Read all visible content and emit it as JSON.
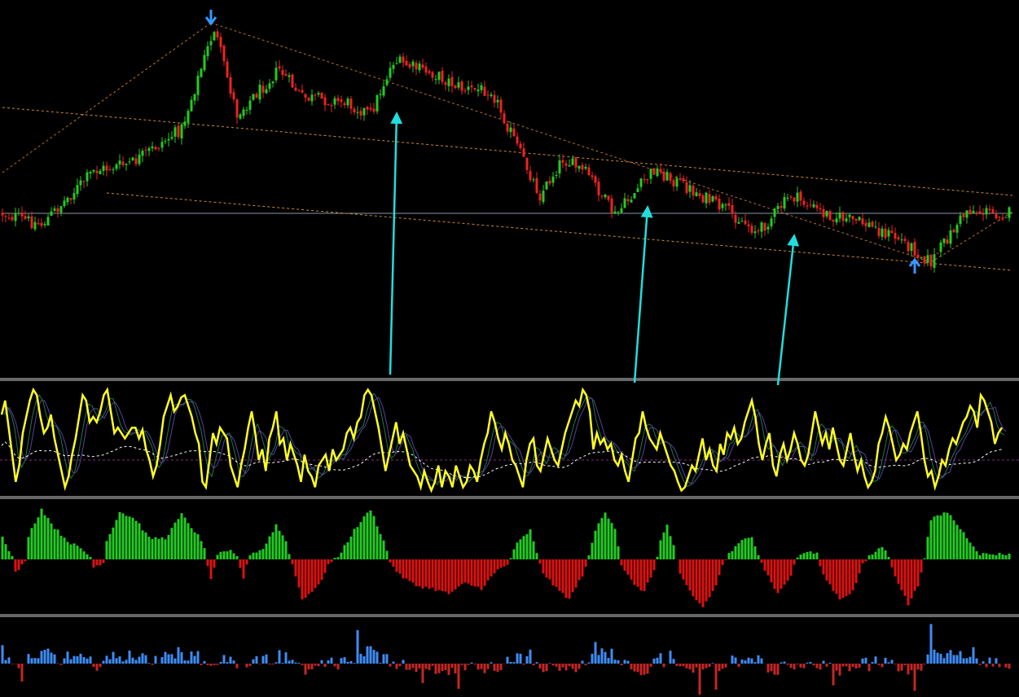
{
  "chart_data": [
    {
      "type": "candlestick",
      "panel": "price",
      "colors": {
        "up": "#22cc22",
        "down": "#ee2222",
        "wick_up": "#22cc22",
        "wick_down": "#ee2222"
      },
      "key_points": [
        {
          "bar": 0,
          "price": 262
        },
        {
          "bar": 12,
          "price": 276
        },
        {
          "bar": 28,
          "price": 210
        },
        {
          "bar": 40,
          "price": 200
        },
        {
          "bar": 55,
          "price": 158
        },
        {
          "bar": 65,
          "price": 35
        },
        {
          "bar": 72,
          "price": 140
        },
        {
          "bar": 85,
          "price": 85
        },
        {
          "bar": 92,
          "price": 120
        },
        {
          "bar": 105,
          "price": 125
        },
        {
          "bar": 113,
          "price": 140
        },
        {
          "bar": 120,
          "price": 75
        },
        {
          "bar": 132,
          "price": 90
        },
        {
          "bar": 142,
          "price": 110
        },
        {
          "bar": 150,
          "price": 110
        },
        {
          "bar": 158,
          "price": 180
        },
        {
          "bar": 165,
          "price": 240
        },
        {
          "bar": 172,
          "price": 195
        },
        {
          "bar": 180,
          "price": 215
        },
        {
          "bar": 188,
          "price": 265
        },
        {
          "bar": 200,
          "price": 208
        },
        {
          "bar": 210,
          "price": 230
        },
        {
          "bar": 222,
          "price": 258
        },
        {
          "bar": 232,
          "price": 285
        },
        {
          "bar": 242,
          "price": 240
        },
        {
          "bar": 252,
          "price": 262
        },
        {
          "bar": 265,
          "price": 275
        },
        {
          "bar": 276,
          "price": 295
        },
        {
          "bar": 285,
          "price": 322
        },
        {
          "bar": 296,
          "price": 258
        },
        {
          "bar": 305,
          "price": 262
        }
      ],
      "signals": [
        {
          "kind": "sell-arrow",
          "bar": 64,
          "color": "#3399ff"
        },
        {
          "kind": "buy-arrow",
          "bar": 280,
          "color": "#3399ff"
        }
      ],
      "lines": [
        {
          "name": "horizontal",
          "from": [
            0,
            262
          ],
          "to": [
            310,
            262
          ],
          "color": "#8899aa",
          "style": "solid"
        },
        {
          "name": "channel-upper",
          "from": [
            0,
            132
          ],
          "to": [
            310,
            240
          ],
          "color": "#d08a30",
          "style": "dashed"
        },
        {
          "name": "channel-lower",
          "from": [
            32,
            237
          ],
          "to": [
            310,
            332
          ],
          "color": "#d08a30",
          "style": "dashed"
        },
        {
          "name": "trend-rise",
          "from": [
            0,
            212
          ],
          "to": [
            64,
            28
          ],
          "color": "#b86e25",
          "style": "dashed"
        },
        {
          "name": "trend-fall",
          "from": [
            64,
            28
          ],
          "to": [
            285,
            322
          ],
          "color": "#b86e25",
          "style": "dashed"
        },
        {
          "name": "trend-end",
          "from": [
            285,
            322
          ],
          "to": [
            310,
            260
          ],
          "color": "#b86e25",
          "style": "dashed"
        }
      ],
      "annotation_arrows": [
        {
          "from_bar": 119,
          "from_y": 460,
          "to_bar": 121,
          "to_y": 140,
          "color": "#22dddd"
        },
        {
          "from_bar": 194,
          "from_y": 470,
          "to_bar": 198,
          "to_y": 255,
          "color": "#22dddd"
        },
        {
          "from_bar": 238,
          "from_y": 473,
          "to_bar": 243,
          "to_y": 290,
          "color": "#22dddd"
        }
      ]
    },
    {
      "type": "line",
      "panel": "oscillator",
      "series": [
        {
          "role": "main",
          "color": "#ffff22",
          "width": 2.5
        },
        {
          "role": "shadow-1",
          "color": "#1c7a4a",
          "width": 1
        },
        {
          "role": "shadow-2",
          "color": "#5a3fa0",
          "width": 1
        },
        {
          "role": "signal",
          "color": "#ffffff",
          "width": 1,
          "style": "dashed"
        }
      ],
      "level": {
        "value": 0,
        "color": "#8a2a8a",
        "style": "dashed"
      },
      "main_values": [
        0.72,
        0.85,
        0.6,
        0.35,
        0.1,
        0.25,
        0.55,
        0.7,
        0.85,
        0.95,
        0.9,
        0.7,
        0.55,
        0.6,
        0.72,
        0.5,
        0.35,
        0.2,
        0.05,
        0.15,
        0.35,
        0.5,
        0.7,
        0.9,
        0.85,
        0.65,
        0.7,
        0.65,
        0.75,
        0.9,
        0.95,
        0.75,
        0.55,
        0.6,
        0.55,
        0.5,
        0.55,
        0.6,
        0.6,
        0.5,
        0.58,
        0.4,
        0.3,
        0.15,
        0.25,
        0.45,
        0.7,
        0.8,
        0.9,
        0.75,
        0.8,
        0.88,
        0.9,
        0.8,
        0.7,
        0.55,
        0.45,
        0.1,
        0.05,
        0.3,
        0.55,
        0.45,
        0.6,
        0.55,
        0.5,
        0.25,
        0.15,
        0.05,
        0.25,
        0.4,
        0.6,
        0.75,
        0.55,
        0.3,
        0.4,
        0.2,
        0.5,
        0.6,
        0.75,
        0.45,
        0.5,
        0.3,
        0.45,
        0.35,
        0.25,
        0.1,
        0.35,
        0.2,
        0.15,
        0.05,
        0.25,
        0.3,
        0.35,
        0.2,
        0.4,
        0.3,
        0.35,
        0.4,
        0.55,
        0.6,
        0.5,
        0.65,
        0.7,
        0.9,
        0.95,
        0.9,
        0.75,
        0.6,
        0.4,
        0.2,
        0.35,
        0.5,
        0.65,
        0.45,
        0.55,
        0.4,
        0.25,
        0.2,
        0.15,
        0.05,
        0.2,
        0.1,
        0.02,
        0.1,
        0.25,
        0.05,
        0.2,
        0.15,
        0.05,
        0.25,
        0.15,
        0.05,
        0.1,
        0.25,
        0.2,
        0.1,
        0.3,
        0.45,
        0.55,
        0.75,
        0.65,
        0.5,
        0.4,
        0.55,
        0.45,
        0.3,
        0.25,
        0.15,
        0.05,
        0.3,
        0.45,
        0.5,
        0.25,
        0.2,
        0.35,
        0.5,
        0.4,
        0.3,
        0.25,
        0.4,
        0.55,
        0.65,
        0.75,
        0.85,
        0.8,
        0.95,
        0.9,
        0.75,
        0.4,
        0.55,
        0.45,
        0.5,
        0.4,
        0.45,
        0.3,
        0.25,
        0.35,
        0.2,
        0.1,
        0.3,
        0.5,
        0.55,
        0.75,
        0.6,
        0.5,
        0.45,
        0.4,
        0.55,
        0.45,
        0.35,
        0.25,
        0.2,
        0.1,
        0.02,
        0.05,
        0.15,
        0.25,
        0.2,
        0.35,
        0.5,
        0.3,
        0.4,
        0.25,
        0.2,
        0.45,
        0.35,
        0.55,
        0.5,
        0.6,
        0.45,
        0.5,
        0.65,
        0.75,
        0.85,
        0.7,
        0.45,
        0.3,
        0.45,
        0.55,
        0.25,
        0.15,
        0.35,
        0.45,
        0.3,
        0.4,
        0.55,
        0.45,
        0.3,
        0.25,
        0.35,
        0.55,
        0.75,
        0.6,
        0.45,
        0.55,
        0.4,
        0.6,
        0.45,
        0.3,
        0.25,
        0.4,
        0.55,
        0.35,
        0.2,
        0.3,
        0.15,
        0.05,
        0.1,
        0.2,
        0.45,
        0.55,
        0.7,
        0.6,
        0.45,
        0.3,
        0.35,
        0.45,
        0.4,
        0.55,
        0.65,
        0.75,
        0.55,
        0.3,
        0.15,
        0.2,
        0.05,
        0.15,
        0.3,
        0.25,
        0.4,
        0.5,
        0.45,
        0.55,
        0.65,
        0.7,
        0.8,
        0.75,
        0.6,
        0.9,
        0.85,
        0.75,
        0.65,
        0.45,
        0.55,
        0.6
      ],
      "ylim": [
        0,
        1
      ]
    },
    {
      "type": "bar",
      "panel": "histogram",
      "colors": {
        "positive": "#22cc22",
        "negative": "#dd1111"
      },
      "zero_level": 0,
      "ylim": [
        -1,
        1
      ],
      "envelope": [
        {
          "bar": 0,
          "value": 0.45
        },
        {
          "bar": 3,
          "value": 0.05
        },
        {
          "bar": 4,
          "value": -0.25
        },
        {
          "bar": 7,
          "value": -0.05
        },
        {
          "bar": 8,
          "value": 0.45
        },
        {
          "bar": 12,
          "value": 0.95
        },
        {
          "bar": 16,
          "value": 0.6
        },
        {
          "bar": 20,
          "value": 0.35
        },
        {
          "bar": 24,
          "value": 0.2
        },
        {
          "bar": 27,
          "value": 0.05
        },
        {
          "bar": 28,
          "value": -0.15
        },
        {
          "bar": 31,
          "value": -0.05
        },
        {
          "bar": 32,
          "value": 0.35
        },
        {
          "bar": 36,
          "value": 0.9
        },
        {
          "bar": 41,
          "value": 0.75
        },
        {
          "bar": 45,
          "value": 0.4
        },
        {
          "bar": 50,
          "value": 0.4
        },
        {
          "bar": 55,
          "value": 0.85
        },
        {
          "bar": 60,
          "value": 0.45
        },
        {
          "bar": 62,
          "value": 0.2
        },
        {
          "bar": 64,
          "value": -0.4
        },
        {
          "bar": 66,
          "value": 0.1
        },
        {
          "bar": 70,
          "value": 0.15
        },
        {
          "bar": 72,
          "value": 0.05
        },
        {
          "bar": 74,
          "value": -0.35
        },
        {
          "bar": 76,
          "value": 0.1
        },
        {
          "bar": 80,
          "value": 0.2
        },
        {
          "bar": 84,
          "value": 0.65
        },
        {
          "bar": 87,
          "value": 0.35
        },
        {
          "bar": 89,
          "value": -0.1
        },
        {
          "bar": 92,
          "value": -0.75
        },
        {
          "bar": 97,
          "value": -0.5
        },
        {
          "bar": 100,
          "value": -0.1
        },
        {
          "bar": 103,
          "value": 0.05
        },
        {
          "bar": 108,
          "value": 0.55
        },
        {
          "bar": 113,
          "value": 0.95
        },
        {
          "bar": 117,
          "value": 0.35
        },
        {
          "bar": 119,
          "value": -0.05
        },
        {
          "bar": 122,
          "value": -0.3
        },
        {
          "bar": 127,
          "value": -0.5
        },
        {
          "bar": 132,
          "value": -0.55
        },
        {
          "bar": 137,
          "value": -0.65
        },
        {
          "bar": 142,
          "value": -0.45
        },
        {
          "bar": 147,
          "value": -0.55
        },
        {
          "bar": 152,
          "value": -0.2
        },
        {
          "bar": 155,
          "value": -0.1
        },
        {
          "bar": 158,
          "value": 0.3
        },
        {
          "bar": 162,
          "value": 0.55
        },
        {
          "bar": 164,
          "value": 0.1
        },
        {
          "bar": 166,
          "value": -0.25
        },
        {
          "bar": 170,
          "value": -0.55
        },
        {
          "bar": 174,
          "value": -0.75
        },
        {
          "bar": 178,
          "value": -0.3
        },
        {
          "bar": 180,
          "value": 0.05
        },
        {
          "bar": 182,
          "value": 0.55
        },
        {
          "bar": 185,
          "value": 0.9
        },
        {
          "bar": 188,
          "value": 0.6
        },
        {
          "bar": 190,
          "value": -0.1
        },
        {
          "bar": 194,
          "value": -0.5
        },
        {
          "bar": 197,
          "value": -0.6
        },
        {
          "bar": 200,
          "value": -0.2
        },
        {
          "bar": 202,
          "value": 0.35
        },
        {
          "bar": 204,
          "value": 0.65
        },
        {
          "bar": 206,
          "value": 0.25
        },
        {
          "bar": 208,
          "value": -0.3
        },
        {
          "bar": 212,
          "value": -0.7
        },
        {
          "bar": 215,
          "value": -0.9
        },
        {
          "bar": 219,
          "value": -0.5
        },
        {
          "bar": 221,
          "value": -0.1
        },
        {
          "bar": 223,
          "value": 0.1
        },
        {
          "bar": 227,
          "value": 0.35
        },
        {
          "bar": 230,
          "value": 0.45
        },
        {
          "bar": 232,
          "value": 0.1
        },
        {
          "bar": 234,
          "value": -0.2
        },
        {
          "bar": 238,
          "value": -0.65
        },
        {
          "bar": 242,
          "value": -0.3
        },
        {
          "bar": 244,
          "value": 0.05
        },
        {
          "bar": 247,
          "value": 0.15
        },
        {
          "bar": 250,
          "value": 0.1
        },
        {
          "bar": 252,
          "value": -0.3
        },
        {
          "bar": 257,
          "value": -0.75
        },
        {
          "bar": 261,
          "value": -0.6
        },
        {
          "bar": 264,
          "value": -0.1
        },
        {
          "bar": 266,
          "value": 0.05
        },
        {
          "bar": 270,
          "value": 0.25
        },
        {
          "bar": 272,
          "value": 0.05
        },
        {
          "bar": 274,
          "value": -0.3
        },
        {
          "bar": 278,
          "value": -0.85
        },
        {
          "bar": 281,
          "value": -0.5
        },
        {
          "bar": 283,
          "value": 0.05
        },
        {
          "bar": 285,
          "value": 0.75
        },
        {
          "bar": 290,
          "value": 0.9
        },
        {
          "bar": 295,
          "value": 0.5
        },
        {
          "bar": 300,
          "value": 0.1
        }
      ]
    },
    {
      "type": "bar",
      "panel": "volume-delta",
      "colors": {
        "positive": "#3f8cf5",
        "negative": "#c42626"
      },
      "zero_level": 0,
      "ylim": [
        -1,
        1
      ],
      "seed": 7
    }
  ]
}
